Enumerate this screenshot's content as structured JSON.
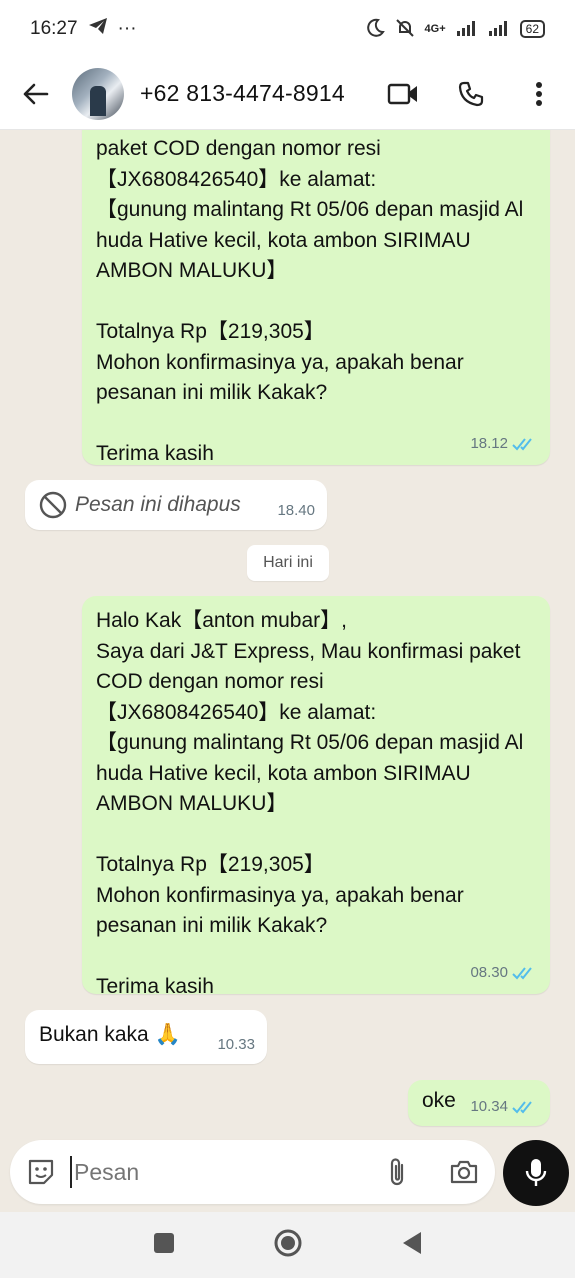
{
  "status_bar": {
    "time": "16:27",
    "more": "···",
    "network": "4G+",
    "battery": "62"
  },
  "header": {
    "contact": "+62 813-4474-8914"
  },
  "messages": [
    {
      "text": "paket COD dengan nomor resi\n【JX6808426540】ke alamat:\n【gunung malintang Rt 05/06 depan masjid Al huda Hative kecil, kota ambon  SIRIMAU AMBON MALUKU】\n\nTotalnya Rp【219,305】\nMohon konfirmasinya ya, apakah benar pesanan ini milik Kakak?\n\nTerima kasih",
      "time": "18.12"
    },
    {
      "text": "Pesan ini dihapus",
      "time": "18.40"
    },
    {
      "text": "Halo Kak【anton mubar】,\nSaya dari J&T Express, Mau konfirmasi paket COD dengan nomor resi\n【JX6808426540】ke alamat:\n【gunung malintang Rt 05/06 depan masjid Al huda Hative kecil, kota ambon  SIRIMAU AMBON MALUKU】\n\nTotalnya Rp【219,305】\nMohon konfirmasinya ya, apakah benar pesanan ini milik Kakak?\n\nTerima kasih",
      "time": "08.30"
    },
    {
      "text": "Bukan kaka 🙏",
      "time": "10.33"
    },
    {
      "text": "oke",
      "time": "10.34"
    }
  ],
  "date_separator": "Hari ini",
  "input": {
    "placeholder": "Pesan"
  },
  "colors": {
    "outgoing_bubble": "#dcf8c6",
    "incoming_bubble": "#ffffff",
    "read_ticks": "#53bdeb",
    "chat_background": "#efeae2"
  }
}
